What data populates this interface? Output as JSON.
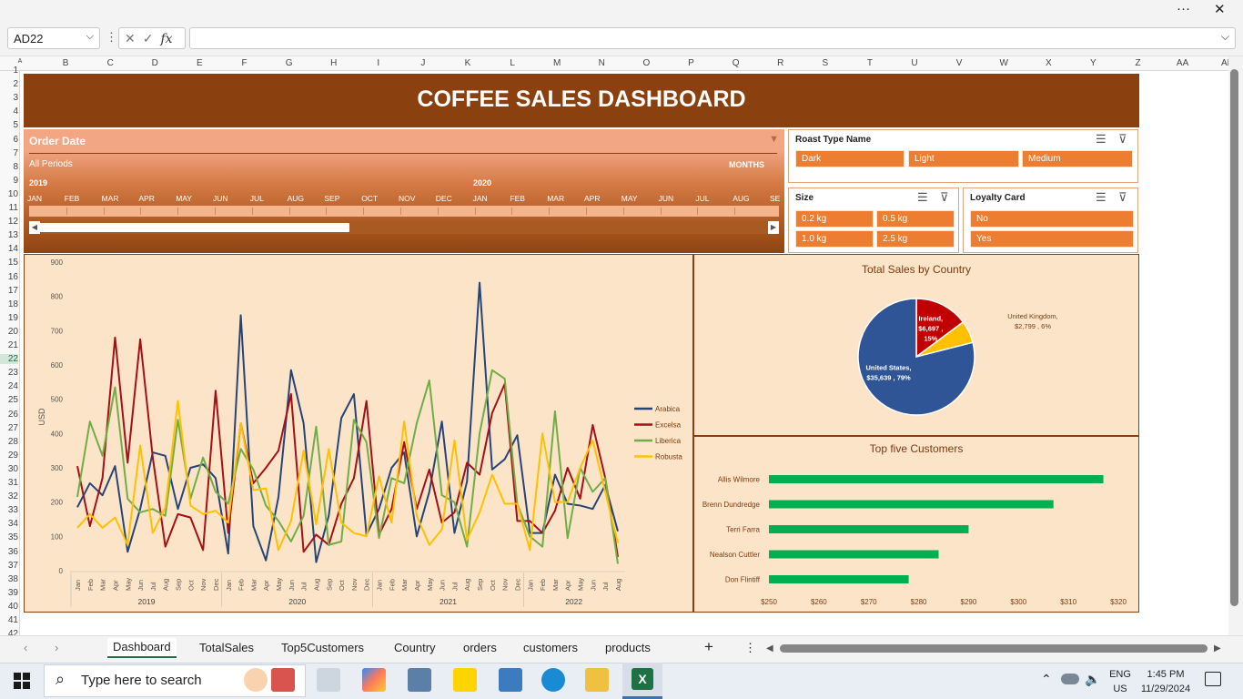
{
  "window": {
    "more_glyph": "···",
    "close_glyph": "✕"
  },
  "formula_bar": {
    "name_box": "AD22",
    "fx_label": "fx",
    "formula": ""
  },
  "columns": [
    "A",
    "B",
    "C",
    "D",
    "E",
    "F",
    "G",
    "H",
    "I",
    "J",
    "K",
    "L",
    "M",
    "N",
    "O",
    "P",
    "Q",
    "R",
    "S",
    "T",
    "U",
    "V",
    "W",
    "X",
    "Y",
    "Z",
    "AA",
    "AB"
  ],
  "rows": [
    "1",
    "2",
    "3",
    "4",
    "5",
    "6",
    "7",
    "8",
    "9",
    "10",
    "11",
    "12",
    "13",
    "14",
    "15",
    "16",
    "17",
    "18",
    "19",
    "20",
    "21",
    "22",
    "23",
    "24",
    "25",
    "26",
    "27",
    "28",
    "29",
    "30",
    "31",
    "32",
    "33",
    "34",
    "35",
    "36",
    "37",
    "38",
    "39",
    "40",
    "41",
    "42"
  ],
  "dashboard": {
    "title": "COFFEE SALES DASHBOARD"
  },
  "timeline": {
    "title": "Order Date",
    "periods": "All Periods",
    "unit": "MONTHS",
    "years": [
      "2019",
      "2020"
    ],
    "months": [
      "JAN",
      "FEB",
      "MAR",
      "APR",
      "MAY",
      "JUN",
      "JUL",
      "AUG",
      "SEP",
      "OCT",
      "NOV",
      "DEC",
      "JAN",
      "FEB",
      "MAR",
      "APR",
      "MAY",
      "JUN",
      "JUL",
      "AUG",
      "SE"
    ]
  },
  "slicers": {
    "roast": {
      "title": "Roast Type Name",
      "items": [
        "Dark",
        "Light",
        "Medium"
      ]
    },
    "size": {
      "title": "Size",
      "items": [
        "0.2 kg",
        "0.5 kg",
        "1.0 kg",
        "2.5 kg"
      ]
    },
    "loyalty": {
      "title": "Loyalty Card",
      "items": [
        "No",
        "Yes"
      ]
    }
  },
  "chart_data": [
    {
      "type": "line",
      "title": "",
      "ylabel": "USD",
      "ylim": [
        0,
        900
      ],
      "yticks": [
        0,
        100,
        200,
        300,
        400,
        500,
        600,
        700,
        800,
        900
      ],
      "x_months": [
        "Jan",
        "Feb",
        "Mar",
        "Apr",
        "May",
        "Jun",
        "Jul",
        "Aug",
        "Sep",
        "Oct",
        "Nov",
        "Dec",
        "Jan",
        "Feb",
        "Mar",
        "Apr",
        "May",
        "Jun",
        "Jul",
        "Aug",
        "Sep",
        "Oct",
        "Nov",
        "Dec",
        "Jan",
        "Feb",
        "Mar",
        "Apr",
        "May",
        "Jun",
        "Jul",
        "Aug",
        "Sep",
        "Oct",
        "Nov",
        "Dec",
        "Jan",
        "Feb",
        "Mar",
        "Apr",
        "May",
        "Jun",
        "Jul",
        "Aug"
      ],
      "x_years": [
        {
          "label": "2019",
          "span": 12
        },
        {
          "label": "2020",
          "span": 12
        },
        {
          "label": "2021",
          "span": 12
        },
        {
          "label": "2022",
          "span": 8
        }
      ],
      "legend_position": "right",
      "series": [
        {
          "name": "Arabica",
          "color": "#264478",
          "values": [
            185,
            255,
            220,
            305,
            55,
            180,
            345,
            335,
            180,
            300,
            310,
            270,
            50,
            745,
            130,
            30,
            215,
            585,
            430,
            25,
            160,
            445,
            515,
            105,
            180,
            300,
            345,
            100,
            230,
            435,
            110,
            260,
            840,
            295,
            325,
            395,
            110,
            110,
            280,
            195,
            190,
            180,
            250,
            115
          ]
        },
        {
          "name": "Excelsa",
          "color": "#a50f15",
          "values": [
            305,
            130,
            270,
            680,
            315,
            675,
            330,
            70,
            165,
            155,
            60,
            525,
            110,
            430,
            255,
            300,
            350,
            515,
            55,
            105,
            75,
            195,
            270,
            495,
            105,
            180,
            375,
            180,
            295,
            140,
            170,
            315,
            280,
            460,
            545,
            145,
            145,
            110,
            175,
            300,
            210,
            425,
            270,
            40
          ]
        },
        {
          "name": "Liberica",
          "color": "#70ad47",
          "values": [
            215,
            435,
            335,
            535,
            210,
            170,
            180,
            160,
            440,
            210,
            330,
            230,
            195,
            355,
            295,
            190,
            145,
            85,
            160,
            420,
            75,
            85,
            440,
            375,
            95,
            270,
            255,
            430,
            555,
            220,
            200,
            70,
            400,
            585,
            560,
            195,
            100,
            70,
            465,
            95,
            300,
            230,
            270,
            20
          ]
        },
        {
          "name": "Robusta",
          "color": "#ffc000",
          "values": [
            125,
            165,
            125,
            155,
            75,
            365,
            110,
            185,
            495,
            190,
            165,
            175,
            140,
            430,
            235,
            240,
            60,
            145,
            350,
            135,
            355,
            140,
            110,
            100,
            275,
            140,
            435,
            160,
            75,
            120,
            380,
            90,
            170,
            280,
            195,
            195,
            60,
            400,
            200,
            200,
            300,
            380,
            230,
            80
          ]
        }
      ]
    },
    {
      "type": "pie",
      "title": "Total Sales by Country",
      "slices": [
        {
          "label": "United States",
          "value": 35639,
          "value_text": "$35,639",
          "pct": 79,
          "color": "#2f5597"
        },
        {
          "label": "Ireland",
          "value": 6697,
          "value_text": "$6,697",
          "pct": 15,
          "color": "#c00000"
        },
        {
          "label": "United Kingdom",
          "value": 2799,
          "value_text": "$2,799",
          "pct": 6,
          "color": "#ffc000"
        }
      ]
    },
    {
      "type": "bar",
      "orientation": "horizontal",
      "title": "Top five Customers",
      "color": "#00b050",
      "xlim": [
        250,
        320
      ],
      "xticks": [
        "$250",
        "$260",
        "$270",
        "$280",
        "$290",
        "$300",
        "$310",
        "$320"
      ],
      "categories": [
        "Allis Wilmore",
        "Brenn Dundredge",
        "Terri Farra",
        "Nealson Cuttler",
        "Don Flintiff"
      ],
      "values": [
        317,
        307,
        290,
        284,
        278
      ]
    }
  ],
  "sheet_tabs": [
    "Dashboard",
    "TotalSales",
    "Top5Customers",
    "Country",
    "orders",
    "customers",
    "products"
  ],
  "active_tab": "Dashboard",
  "taskbar": {
    "search_placeholder": "Type here to search",
    "lang_top": "ENG",
    "lang_bottom": "US",
    "time": "1:45 PM",
    "date": "11/29/2024"
  }
}
